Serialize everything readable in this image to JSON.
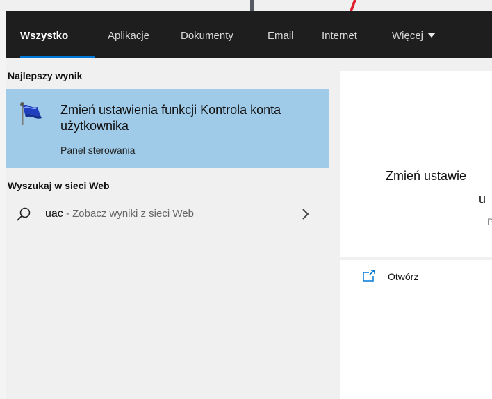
{
  "tabs": [
    {
      "label": "Wszystko"
    },
    {
      "label": "Aplikacje"
    },
    {
      "label": "Dokumenty"
    },
    {
      "label": "Email"
    },
    {
      "label": "Internet"
    },
    {
      "label": "Więcej"
    }
  ],
  "best_match": {
    "header": "Najlepszy wynik",
    "title": "Zmień ustawienia funkcji Kontrola konta użytkownika",
    "subtitle": "Panel sterowania",
    "icon": "uac-flag-icon"
  },
  "web": {
    "header": "Wyszukaj w sieci Web",
    "query": "uac",
    "hint": " - Zobacz wyniki z sieci Web"
  },
  "detail": {
    "title_line1": "Zmień ustawie",
    "title_line2": "u",
    "subtitle": "P"
  },
  "actions": {
    "open_label": "Otwórz"
  },
  "colors": {
    "tab_bar": "#1e1e1e",
    "accent": "#0078d7",
    "selected_row": "#9fcbe8",
    "panel_bg": "#f0f0f0"
  }
}
